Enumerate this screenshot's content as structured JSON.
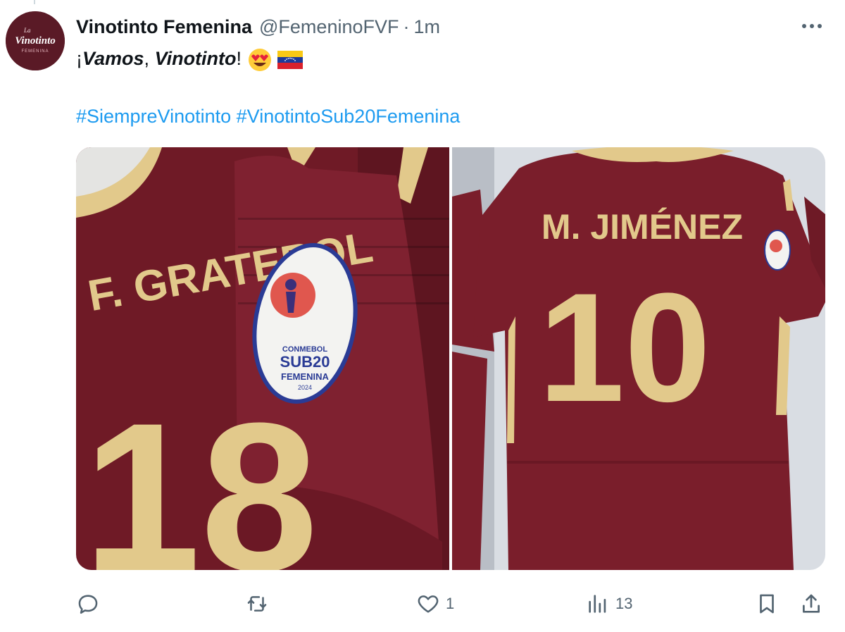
{
  "account": {
    "display_name": "Vinotinto Femenina",
    "handle": "@FemeninoFVF",
    "separator": "·",
    "time": "1m",
    "avatar_text_top": "La",
    "avatar_text_main": "Vinotinto",
    "avatar_text_sub": "FEMENINA"
  },
  "tweet": {
    "prefix": "¡",
    "word1": "Vamos",
    "comma": ", ",
    "word2": "Vinotinto",
    "suffix": "!",
    "emojis": [
      "smiling-face-with-heart-eyes",
      "venezuela-flag"
    ],
    "hashtags": [
      "#SiempreVinotinto",
      "#VinotintoSub20Femenina"
    ]
  },
  "media": {
    "left": {
      "jersey_name": "F. GRATEROL",
      "jersey_number": "18",
      "patch_line1": "CONMEBOL",
      "patch_line2": "SUB20",
      "patch_line3": "FEMENINA",
      "patch_line4": "2024"
    },
    "right": {
      "jersey_name": "M. JIMÉNEZ",
      "jersey_number": "10"
    }
  },
  "actions": {
    "reply_count": "",
    "retweet_count": "",
    "like_count": "1",
    "views_count": "13"
  },
  "colors": {
    "link": "#1d9bf0",
    "muted": "#536471",
    "jersey": "#7a1e2b",
    "jersey_trim": "#e9d29a"
  }
}
